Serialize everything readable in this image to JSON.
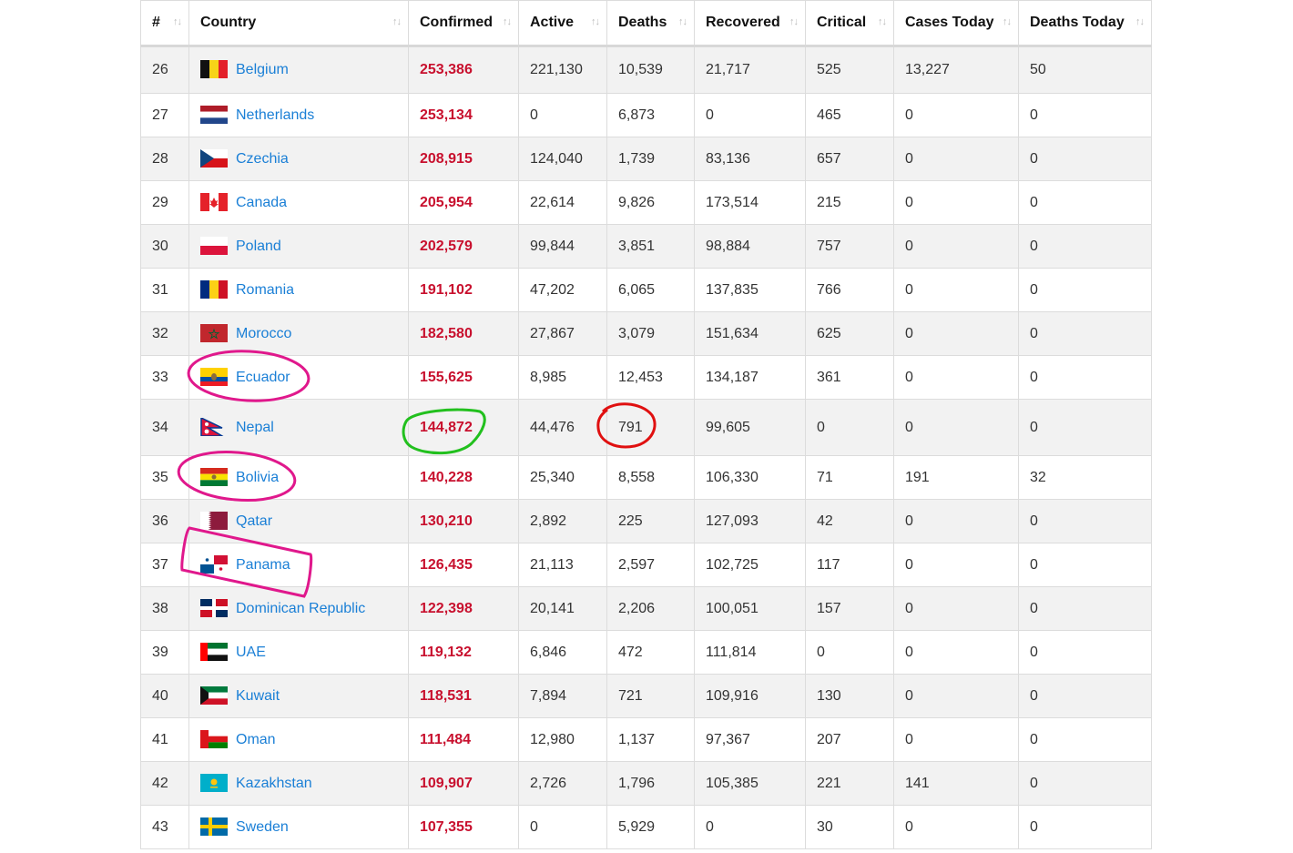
{
  "table": {
    "headers": {
      "rank": "#",
      "country": "Country",
      "confirmed": "Confirmed",
      "active": "Active",
      "deaths": "Deaths",
      "recovered": "Recovered",
      "critical": "Critical",
      "cases_today": "Cases Today",
      "deaths_today": "Deaths Today"
    },
    "rows": [
      {
        "rank": "26",
        "country": "Belgium",
        "confirmed": "253,386",
        "active": "221,130",
        "deaths": "10,539",
        "recovered": "21,717",
        "critical": "525",
        "cases_today": "13,227",
        "deaths_today": "50"
      },
      {
        "rank": "27",
        "country": "Netherlands",
        "confirmed": "253,134",
        "active": "0",
        "deaths": "6,873",
        "recovered": "0",
        "critical": "465",
        "cases_today": "0",
        "deaths_today": "0"
      },
      {
        "rank": "28",
        "country": "Czechia",
        "confirmed": "208,915",
        "active": "124,040",
        "deaths": "1,739",
        "recovered": "83,136",
        "critical": "657",
        "cases_today": "0",
        "deaths_today": "0"
      },
      {
        "rank": "29",
        "country": "Canada",
        "confirmed": "205,954",
        "active": "22,614",
        "deaths": "9,826",
        "recovered": "173,514",
        "critical": "215",
        "cases_today": "0",
        "deaths_today": "0"
      },
      {
        "rank": "30",
        "country": "Poland",
        "confirmed": "202,579",
        "active": "99,844",
        "deaths": "3,851",
        "recovered": "98,884",
        "critical": "757",
        "cases_today": "0",
        "deaths_today": "0"
      },
      {
        "rank": "31",
        "country": "Romania",
        "confirmed": "191,102",
        "active": "47,202",
        "deaths": "6,065",
        "recovered": "137,835",
        "critical": "766",
        "cases_today": "0",
        "deaths_today": "0"
      },
      {
        "rank": "32",
        "country": "Morocco",
        "confirmed": "182,580",
        "active": "27,867",
        "deaths": "3,079",
        "recovered": "151,634",
        "critical": "625",
        "cases_today": "0",
        "deaths_today": "0"
      },
      {
        "rank": "33",
        "country": "Ecuador",
        "confirmed": "155,625",
        "active": "8,985",
        "deaths": "12,453",
        "recovered": "134,187",
        "critical": "361",
        "cases_today": "0",
        "deaths_today": "0"
      },
      {
        "rank": "34",
        "country": "Nepal",
        "confirmed": "144,872",
        "active": "44,476",
        "deaths": "791",
        "recovered": "99,605",
        "critical": "0",
        "cases_today": "0",
        "deaths_today": "0"
      },
      {
        "rank": "35",
        "country": "Bolivia",
        "confirmed": "140,228",
        "active": "25,340",
        "deaths": "8,558",
        "recovered": "106,330",
        "critical": "71",
        "cases_today": "191",
        "deaths_today": "32"
      },
      {
        "rank": "36",
        "country": "Qatar",
        "confirmed": "130,210",
        "active": "2,892",
        "deaths": "225",
        "recovered": "127,093",
        "critical": "42",
        "cases_today": "0",
        "deaths_today": "0"
      },
      {
        "rank": "37",
        "country": "Panama",
        "confirmed": "126,435",
        "active": "21,113",
        "deaths": "2,597",
        "recovered": "102,725",
        "critical": "117",
        "cases_today": "0",
        "deaths_today": "0"
      },
      {
        "rank": "38",
        "country": "Dominican Republic",
        "confirmed": "122,398",
        "active": "20,141",
        "deaths": "2,206",
        "recovered": "100,051",
        "critical": "157",
        "cases_today": "0",
        "deaths_today": "0"
      },
      {
        "rank": "39",
        "country": "UAE",
        "confirmed": "119,132",
        "active": "6,846",
        "deaths": "472",
        "recovered": "111,814",
        "critical": "0",
        "cases_today": "0",
        "deaths_today": "0"
      },
      {
        "rank": "40",
        "country": "Kuwait",
        "confirmed": "118,531",
        "active": "7,894",
        "deaths": "721",
        "recovered": "109,916",
        "critical": "130",
        "cases_today": "0",
        "deaths_today": "0"
      },
      {
        "rank": "41",
        "country": "Oman",
        "confirmed": "111,484",
        "active": "12,980",
        "deaths": "1,137",
        "recovered": "97,367",
        "critical": "207",
        "cases_today": "0",
        "deaths_today": "0"
      },
      {
        "rank": "42",
        "country": "Kazakhstan",
        "confirmed": "109,907",
        "active": "2,726",
        "deaths": "1,796",
        "recovered": "105,385",
        "critical": "221",
        "cases_today": "141",
        "deaths_today": "0"
      },
      {
        "rank": "43",
        "country": "Sweden",
        "confirmed": "107,355",
        "active": "0",
        "deaths": "5,929",
        "recovered": "0",
        "critical": "30",
        "cases_today": "0",
        "deaths_today": "0"
      }
    ]
  },
  "colors": {
    "confirmed_text": "#c8102e",
    "country_link": "#1a7fd6",
    "annotation_magenta": "#e0188c",
    "annotation_green": "#22c01e",
    "annotation_red": "#e01010"
  },
  "icons": {
    "sort": "sort-arrows-icon",
    "flags": [
      "belgium-flag-icon",
      "netherlands-flag-icon",
      "czechia-flag-icon",
      "canada-flag-icon",
      "poland-flag-icon",
      "romania-flag-icon",
      "morocco-flag-icon",
      "ecuador-flag-icon",
      "nepal-flag-icon",
      "bolivia-flag-icon",
      "qatar-flag-icon",
      "panama-flag-icon",
      "dominican-republic-flag-icon",
      "uae-flag-icon",
      "kuwait-flag-icon",
      "oman-flag-icon",
      "kazakhstan-flag-icon",
      "sweden-flag-icon"
    ]
  }
}
